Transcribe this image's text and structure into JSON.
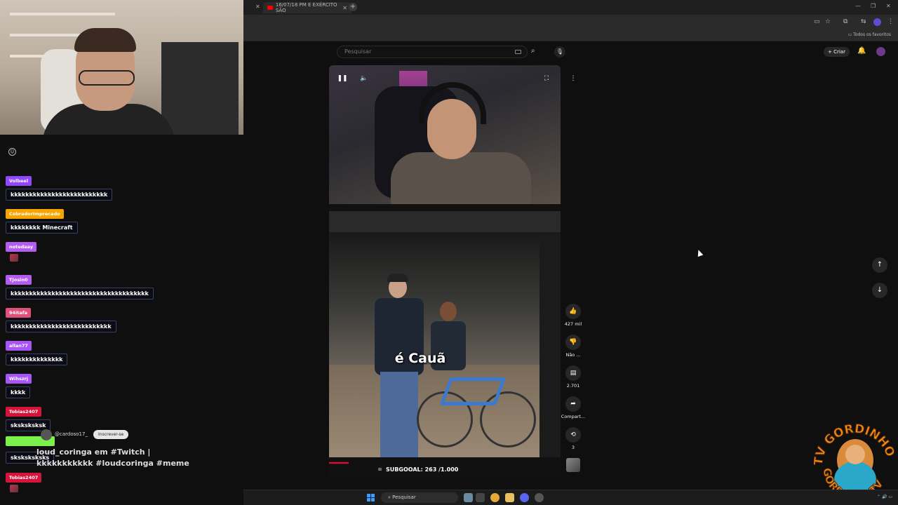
{
  "browser": {
    "tab_title": "16/07/18 PM E EXÉRCITO SÃO",
    "bookmarks_label": "Todos os favoritos"
  },
  "youtube": {
    "search_placeholder": "Pesquisar",
    "create_label": "Criar"
  },
  "chat": {
    "messages": [
      {
        "user": "Volbeel",
        "color": "#9147ff",
        "text": "kkkkkkkkkkkkkkkkkkkkkkkkkk"
      },
      {
        "user": "CobradorImprecado",
        "color": "#f5a400",
        "text": "kkkkkkkk Minecraft"
      },
      {
        "user": "notedaay",
        "color": "#b45cf0",
        "text": ""
      },
      {
        "user": "TJosin0",
        "color": "#b45cf0",
        "text": "kkkkkkkkkkkkkkkkkkkkkkkkkkkkkkkkkkkkk"
      },
      {
        "user": "94itafa",
        "color": "#e0507a",
        "text": "kkkkkkkkkkkkkkkkkkkkkkkkkkk"
      },
      {
        "user": "allan77",
        "color": "#a855f7",
        "text": "kkkkkkkkkkkkkk"
      },
      {
        "user": "Wihszrj",
        "color": "#a855f7",
        "text": "kkkk"
      },
      {
        "user": "Tobias2407",
        "color": "#d4143a",
        "text": "sksksksksk"
      },
      {
        "user": "",
        "color": "#7cf04a",
        "text": "sksksksksks"
      },
      {
        "user": "Tobias2407",
        "color": "#d4143a",
        "text": ""
      }
    ]
  },
  "short": {
    "channel_handle": "@cardoso17_",
    "subscribe_label": "Inscrever-se",
    "title": "loud_coringa em #Twitch | kkkkkkkkkkk #loudcoringa #meme",
    "caption": "é Cauã",
    "subs_text": "SUBGOOAL: 263 /1.000"
  },
  "actions": {
    "likes": "427 mil",
    "dislike_label": "Não ...",
    "comments": "2.701",
    "share_label": "Compart...",
    "remix_count": "3"
  },
  "taskbar": {
    "search_label": "Pesquisar"
  },
  "logo": {
    "top_text": "TV GORDINHO",
    "bottom_text": "GORDINHO TV"
  },
  "colors": {
    "youtube_red": "#ff0000",
    "progress": "#ff0033"
  }
}
